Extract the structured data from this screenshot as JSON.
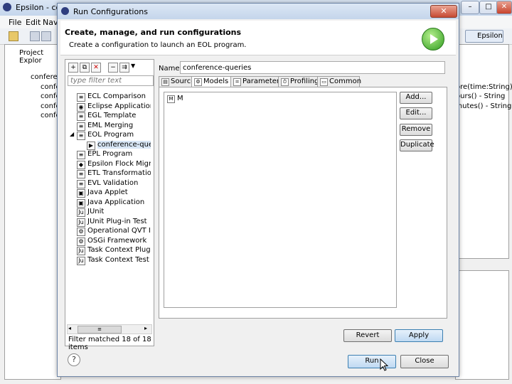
{
  "background": {
    "title": "Epsilon - confe",
    "menu": [
      "File",
      "Edit",
      "Navi"
    ],
    "left_view_title": "Project Explor",
    "left_items": [
      "conferen",
      "confe",
      "confe",
      "confe",
      "confe"
    ],
    "perspective": "Epsilon",
    "right_lines": [
      "ore(time:String) :",
      "ours() - String",
      "inutes() - String"
    ]
  },
  "dialog": {
    "title": "Run Configurations",
    "header_title": "Create, manage, and run configurations",
    "header_subtitle": "Create a configuration to launch an EOL program.",
    "filter_placeholder": "type filter text",
    "tree": [
      {
        "label": "ECL Comparison",
        "level": 0
      },
      {
        "label": "Eclipse Application",
        "level": 0
      },
      {
        "label": "EGL Template",
        "level": 0
      },
      {
        "label": "EML Merging",
        "level": 0
      },
      {
        "label": "EOL Program",
        "level": 0,
        "expanded": true
      },
      {
        "label": "conference-queries",
        "level": 1,
        "selected": true
      },
      {
        "label": "EPL Program",
        "level": 0
      },
      {
        "label": "Epsilon Flock Migration",
        "level": 0
      },
      {
        "label": "ETL Transformation",
        "level": 0
      },
      {
        "label": "EVL Validation",
        "level": 0
      },
      {
        "label": "Java Applet",
        "level": 0
      },
      {
        "label": "Java Application",
        "level": 0
      },
      {
        "label": "JUnit",
        "level": 0
      },
      {
        "label": "JUnit Plug-in Test",
        "level": 0
      },
      {
        "label": "Operational QVT Interpreter",
        "level": 0
      },
      {
        "label": "OSGi Framework",
        "level": 0
      },
      {
        "label": "Task Context Plug-in Test",
        "level": 0
      },
      {
        "label": "Task Context Test",
        "level": 0
      }
    ],
    "filter_status": "Filter matched 18 of 18 items",
    "name_label": "Name:",
    "name_value": "conference-queries",
    "tabs": [
      "Source",
      "Models",
      "Parameters",
      "Profiling",
      "Common"
    ],
    "active_tab": "Models",
    "models": [
      "M"
    ],
    "side_buttons": [
      "Add...",
      "Edit...",
      "Remove",
      "Duplicate"
    ],
    "revert_label": "Revert",
    "apply_label": "Apply",
    "run_label": "Run",
    "close_label": "Close",
    "help_glyph": "?"
  }
}
